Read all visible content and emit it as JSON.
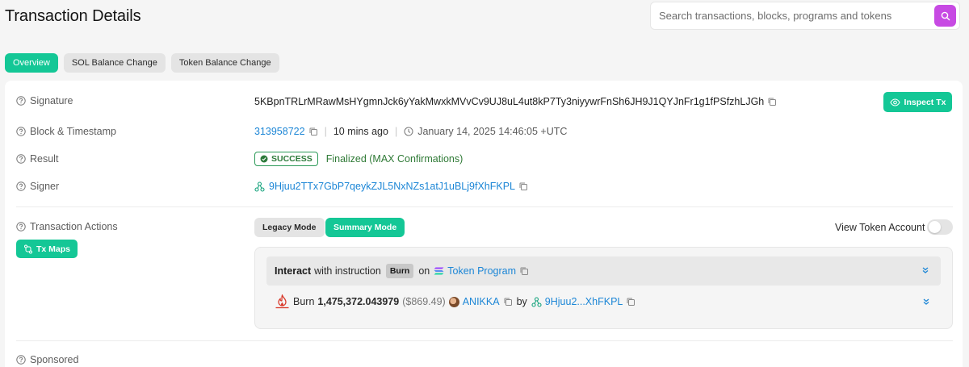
{
  "page": {
    "title": "Transaction Details",
    "search_placeholder": "Search transactions, blocks, programs and tokens"
  },
  "tabs": [
    "Overview",
    "SOL Balance Change",
    "Token Balance Change"
  ],
  "colors": {
    "accent": "#14c796",
    "search_button": "#c74ae3",
    "link": "#1c86d6",
    "success": "#2c9a58"
  },
  "rows": {
    "signature": {
      "label": "Signature",
      "value": "5KBpnTRLrMRawMsHYgmnJck6yYakMwxkMVvCv9UJ8uL4ut8kP7Ty3niyywrFnSh6JH9J1QYJnFr1g1fPSfzhLJGh"
    },
    "block": {
      "label": "Block & Timestamp",
      "block": "313958722",
      "relative": "10 mins ago",
      "timestamp": "January 14, 2025 14:46:05 +UTC"
    },
    "result": {
      "label": "Result",
      "badge": "SUCCESS",
      "status": "Finalized (MAX Confirmations)"
    },
    "signer": {
      "label": "Signer",
      "address": "9Hjuu2TTx7GbP7qeykZJL5NxNZs1atJ1uBLj9fXhFKPL"
    },
    "actions": {
      "label": "Transaction Actions"
    },
    "sponsored": {
      "label": "Sponsored"
    }
  },
  "buttons": {
    "inspect": "Inspect Tx",
    "tx_maps": "Tx Maps",
    "legacy_mode": "Legacy Mode",
    "summary_mode": "Summary Mode",
    "view_token_account": "View Token Account"
  },
  "instruction": {
    "interact": "Interact",
    "with_instruction": "with instruction",
    "chip": "Burn",
    "on": "on",
    "program": "Token Program",
    "action": "Burn",
    "amount": "1,475,372.043979",
    "usd": "($869.49)",
    "token": "ANIKKA",
    "by": "by",
    "signer_short": "9Hjuu2...XhFKPL"
  },
  "icons": {
    "search": "search-icon",
    "help": "question-circle-icon",
    "copy": "copy-icon",
    "eye": "eye-icon",
    "clock": "clock-icon",
    "check": "check-circle-icon",
    "wallet": "wallet-icon",
    "tx_maps": "tx-maps-icon",
    "expand": "chevron-double-down-icon",
    "solana": "solana-icon",
    "burn": "flame-icon"
  }
}
